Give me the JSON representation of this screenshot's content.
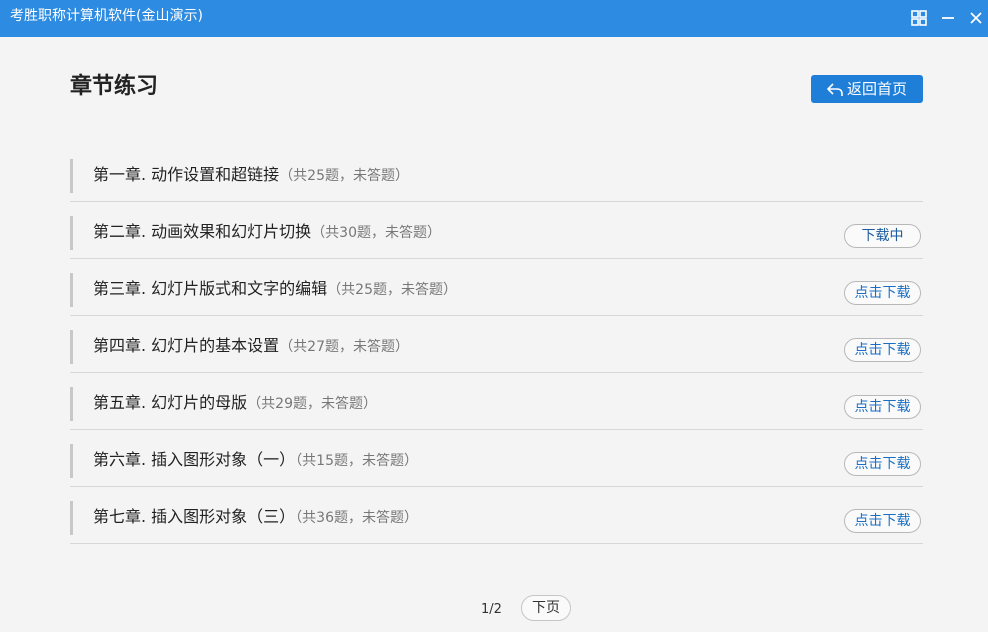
{
  "window": {
    "title": "考胜职称计算机软件(金山演示)",
    "accent_color": "#2d8be1",
    "controls": [
      "grid-icon",
      "minimize-icon",
      "close-icon"
    ]
  },
  "header": {
    "title": "章节练习",
    "home_button": {
      "label": "返回首页",
      "icon": "back-arrow-icon"
    }
  },
  "chapters": [
    {
      "name": "第一章. 动作设置和超链接",
      "meta": "（共25题，未答题）",
      "action": ""
    },
    {
      "name": "第二章. 动画效果和幻灯片切换",
      "meta": "（共30题，未答题）",
      "action": "下载中"
    },
    {
      "name": "第三章. 幻灯片版式和文字的编辑",
      "meta": "（共25题，未答题）",
      "action": "点击下载"
    },
    {
      "name": "第四章. 幻灯片的基本设置",
      "meta": "（共27题，未答题）",
      "action": "点击下载"
    },
    {
      "name": "第五章. 幻灯片的母版",
      "meta": "（共29题，未答题）",
      "action": "点击下载"
    },
    {
      "name": "第六章. 插入图形对象（一）",
      "meta": "（共15题，未答题）",
      "action": "点击下载"
    },
    {
      "name": "第七章. 插入图形对象（三）",
      "meta": "（共36题，未答题）",
      "action": "点击下载"
    }
  ],
  "pagination": {
    "current": "1/2",
    "next_label": "下页"
  }
}
